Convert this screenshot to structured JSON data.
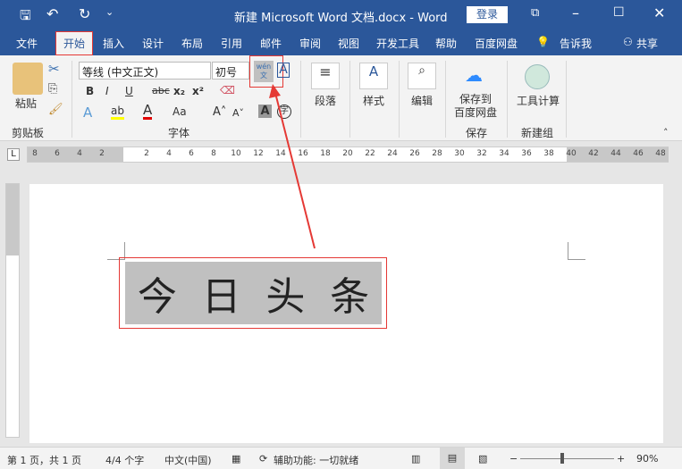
{
  "title": {
    "doc": "新建 Microsoft Word 文档.docx  -  Word",
    "login": "登录"
  },
  "tabs": [
    "文件",
    "开始",
    "插入",
    "设计",
    "布局",
    "引用",
    "邮件",
    "审阅",
    "视图",
    "开发工具",
    "帮助",
    "百度网盘",
    "告诉我",
    "共享"
  ],
  "ribbon": {
    "paste": "粘贴",
    "clipboard": "剪贴板",
    "font_name": "等线 (中文正文)",
    "font_size": "初号",
    "font_group": "字体",
    "phonetic": "wén\n文",
    "paragraph": "段落",
    "styles": "样式",
    "editing": "编辑",
    "save_baidu": "保存到\n百度网盘",
    "save_group": "保存",
    "tools": "工具计算",
    "new_group": "新建组",
    "bold": "B",
    "italic": "I",
    "underline": "U",
    "strike": "abc",
    "sub": "x₂",
    "sup": "x²",
    "aa": "Aa"
  },
  "ruler": {
    "left": [
      "8",
      "6",
      "4",
      "2"
    ],
    "right": [
      "2",
      "4",
      "6",
      "8",
      "10",
      "12",
      "14",
      "16",
      "18",
      "20",
      "22",
      "24",
      "26",
      "28",
      "30",
      "32",
      "34",
      "36",
      "38"
    ],
    "margin": [
      "40",
      "42",
      "44",
      "46",
      "48"
    ]
  },
  "document": {
    "chars": [
      "今",
      "日",
      "头",
      "条"
    ]
  },
  "status": {
    "page": "第 1 页，共 1 页",
    "words": "4/4 个字",
    "lang": "中文(中国)",
    "access": "辅助功能: 一切就绪",
    "zoom": "90%",
    "zoom_percent": 90
  },
  "colors": {
    "accent": "#2b579a",
    "highlight": "#ffff00",
    "font_color": "#e00000",
    "annotation": "#e53935"
  }
}
